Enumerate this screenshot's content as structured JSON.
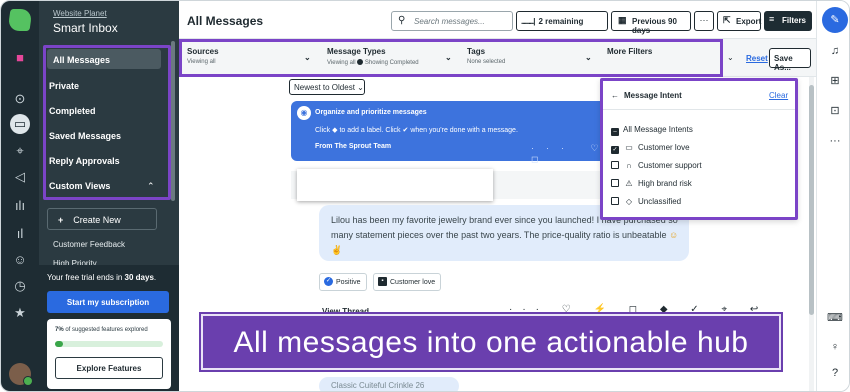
{
  "app": {
    "brand_link": "Website Planet",
    "inbox_title": "Smart Inbox"
  },
  "sidebar": {
    "items": [
      {
        "label": "All Messages",
        "selected": true
      },
      {
        "label": "Private"
      },
      {
        "label": "Completed"
      },
      {
        "label": "Saved Messages"
      },
      {
        "label": "Reply Approvals"
      },
      {
        "label": "Custom Views"
      }
    ],
    "create_new": "Create New",
    "views": [
      "Customer Feedback",
      "High Priority"
    ]
  },
  "trial": {
    "text_pre": "Your free trial ends in ",
    "text_bold": "30 days",
    "text_post": ".",
    "subscribe_label": "Start my subscription",
    "progress_pct": "7%",
    "progress_text": " of suggested features explored",
    "progress_value": 0.07,
    "explore_label": "Explore Features"
  },
  "header": {
    "title": "All Messages",
    "search_placeholder": "Search messages...",
    "remaining_dots": "..........|",
    "remaining_label": "2 remaining",
    "previous_label": "Previous 90 days",
    "more_label": "···",
    "export_label": "Export",
    "filters_label": "Filters"
  },
  "filters": {
    "sources": {
      "label": "Sources",
      "value": "Viewing all"
    },
    "types": {
      "label": "Message Types",
      "value_pre": "Viewing all ",
      "value_post": " Showing Completed"
    },
    "tags": {
      "label": "Tags",
      "value": "None selected"
    },
    "more": {
      "label": "More Filters"
    },
    "reset": "Reset",
    "save": "Save As..."
  },
  "content": {
    "sort_label": "Newest to Oldest",
    "sprout_card": {
      "heading": "Organize and prioritize messages",
      "body_a": "Click ",
      "body_b": " to add a label. Click ",
      "body_c": " when you're done with a message.",
      "from": "From The Sprout Team"
    },
    "message": {
      "text": "Lilou has been my favorite jewelry brand ever since you launched! I have purchased so many statement pieces over the past two years. The price-quality ratio is unbeatable",
      "emoji_a": "☺",
      "emoji_b": "✌"
    },
    "chips": [
      "Positive",
      "Customer love"
    ],
    "view_thread": "View Thread",
    "next_preview": "Classic Cuiteful Crinkle 26"
  },
  "intent": {
    "title": "Message Intent",
    "clear": "Clear",
    "options": [
      {
        "label": "All Message Intents",
        "state": "partial",
        "icon": ""
      },
      {
        "label": "Customer love",
        "state": "checked",
        "icon": "speech-bubble"
      },
      {
        "label": "Customer support",
        "state": "unchecked",
        "icon": "headset"
      },
      {
        "label": "High brand risk",
        "state": "unchecked",
        "icon": "warning"
      },
      {
        "label": "Unclassified",
        "state": "unchecked",
        "icon": "diamond"
      }
    ]
  },
  "banner": {
    "text": "All messages into one actionable hub"
  },
  "colors": {
    "highlight": "#7b44c7",
    "accent": "#2a6ae0",
    "sidebar": "#2b3a41",
    "banner": "#6a3fae"
  }
}
